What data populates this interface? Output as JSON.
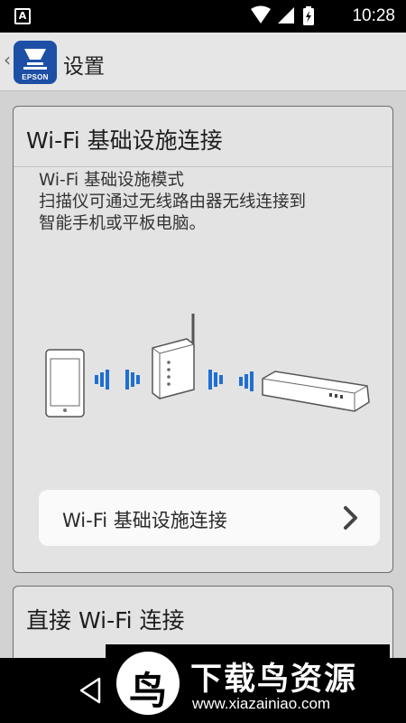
{
  "status_bar": {
    "time": "10:28",
    "notification_glyph": "A",
    "icons": [
      "app-notification-icon",
      "wifi-icon",
      "signal-icon",
      "battery-charging-icon"
    ]
  },
  "app_bar": {
    "back_glyph": "‹",
    "logo_text": "EPSON",
    "title": "设置"
  },
  "card_infrastructure": {
    "title": "Wi-Fi 基础设施连接",
    "description_lines": [
      "Wi-Fi 基础设施模式",
      "扫描仪可通过无线路由器无线连接到",
      "智能手机或平板电脑。"
    ],
    "illustration_icons": [
      "tablet-icon",
      "wireless-signal-icon",
      "router-icon",
      "scanner-icon"
    ],
    "action_button_label": "Wi-Fi 基础设施连接"
  },
  "card_direct": {
    "title": "直接 Wi-Fi 连接"
  },
  "watermark": {
    "logo_glyph": "鸟",
    "title": "下载鸟资源",
    "url": "www.xiazainiao.com"
  },
  "colors": {
    "background": "#d2d2d2",
    "card_bg": "#e3e3e3",
    "accent_blue": "#1d4fa6",
    "signal_blue": "#1f6fd1"
  }
}
